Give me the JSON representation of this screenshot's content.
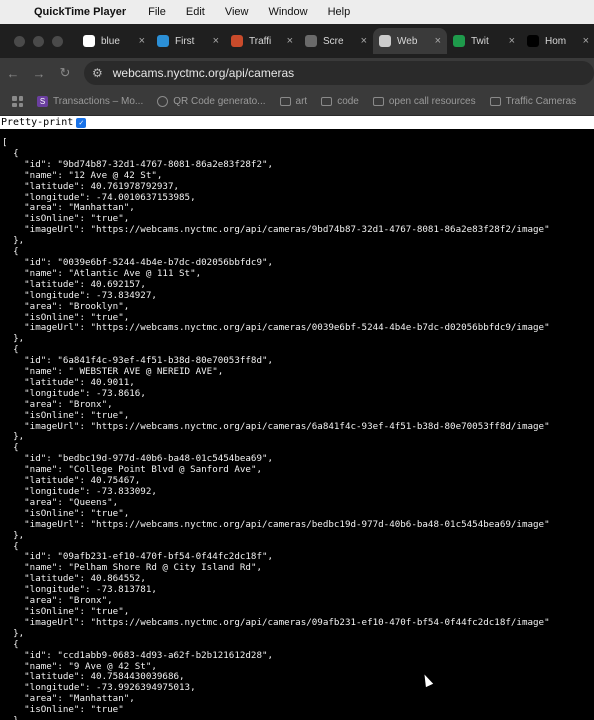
{
  "menubar": {
    "app_name": "QuickTime Player",
    "items": [
      "File",
      "Edit",
      "View",
      "Window",
      "Help"
    ]
  },
  "tabs": [
    {
      "label": "blue",
      "icon": "google-icon",
      "color": "#ffffff"
    },
    {
      "label": "First",
      "icon": "globe-icon",
      "color": "#2b8fd6"
    },
    {
      "label": "Traffi",
      "icon": "traffic-icon",
      "color": "#c94b2b"
    },
    {
      "label": "Scre",
      "icon": "screen-icon",
      "color": "#6a6a6a"
    },
    {
      "label": "Web",
      "icon": "stack-icon",
      "color": "#cccccc",
      "active": true
    },
    {
      "label": "Twit",
      "icon": "sheets-icon",
      "color": "#1e9a4b"
    },
    {
      "label": "Hom",
      "icon": "x-icon",
      "color": "#000000"
    }
  ],
  "address": {
    "url": "webcams.nyctmc.org/api/cameras"
  },
  "bookmarks": [
    {
      "label": "Transactions – Mo...",
      "icon": "s-icon"
    },
    {
      "label": "QR Code generato...",
      "icon": "globe-icon"
    },
    {
      "label": "art",
      "icon": "folder-icon"
    },
    {
      "label": "code",
      "icon": "folder-icon"
    },
    {
      "label": "open call resources",
      "icon": "folder-icon"
    },
    {
      "label": "Traffic Cameras",
      "icon": "folder-icon"
    }
  ],
  "pretty_print_label": "Pretty-print",
  "cameras": [
    {
      "id": "9bd74b87-32d1-4767-8081-86a2e83f28f2",
      "name": "12 Ave @ 42 St",
      "latitude": "40.761978792937",
      "longitude": "-74.0010637153985",
      "area": "Manhattan",
      "isOnline": "true",
      "imageUrl": "https://webcams.nyctmc.org/api/cameras/9bd74b87-32d1-4767-8081-86a2e83f28f2/image"
    },
    {
      "id": "0039e6bf-5244-4b4e-b7dc-d02056bbfdc9",
      "name": "Atlantic Ave @ 111 St",
      "latitude": "40.692157",
      "longitude": "-73.834927",
      "area": "Brooklyn",
      "isOnline": "true",
      "imageUrl": "https://webcams.nyctmc.org/api/cameras/0039e6bf-5244-4b4e-b7dc-d02056bbfdc9/image"
    },
    {
      "id": "6a841f4c-93ef-4f51-b38d-80e70053ff8d",
      "name": " WEBSTER AVE @ NEREID AVE",
      "latitude": "40.9011",
      "longitude": "-73.8616",
      "area": "Bronx",
      "isOnline": "true",
      "imageUrl": "https://webcams.nyctmc.org/api/cameras/6a841f4c-93ef-4f51-b38d-80e70053ff8d/image"
    },
    {
      "id": "bedbc19d-977d-40b6-ba48-01c5454bea69",
      "name": "College Point Blvd @ Sanford Ave",
      "latitude": "40.75467",
      "longitude": "-73.833092",
      "area": "Queens",
      "isOnline": "true",
      "imageUrl": "https://webcams.nyctmc.org/api/cameras/bedbc19d-977d-40b6-ba48-01c5454bea69/image"
    },
    {
      "id": "09afb231-ef10-470f-bf54-0f44fc2dc18f",
      "name": "Pelham Shore Rd @ City Island Rd",
      "latitude": "40.864552",
      "longitude": "-73.813781",
      "area": "Bronx",
      "isOnline": "true",
      "imageUrl": "https://webcams.nyctmc.org/api/cameras/09afb231-ef10-470f-bf54-0f44fc2dc18f/image"
    },
    {
      "id": "ccd1abb9-0683-4d93-a62f-b2b121612d28",
      "name": "9 Ave @ 42 St",
      "latitude": "40.7584430039686",
      "longitude": "-73.9926394975013",
      "area": "Manhattan",
      "isOnline": "true"
    }
  ]
}
